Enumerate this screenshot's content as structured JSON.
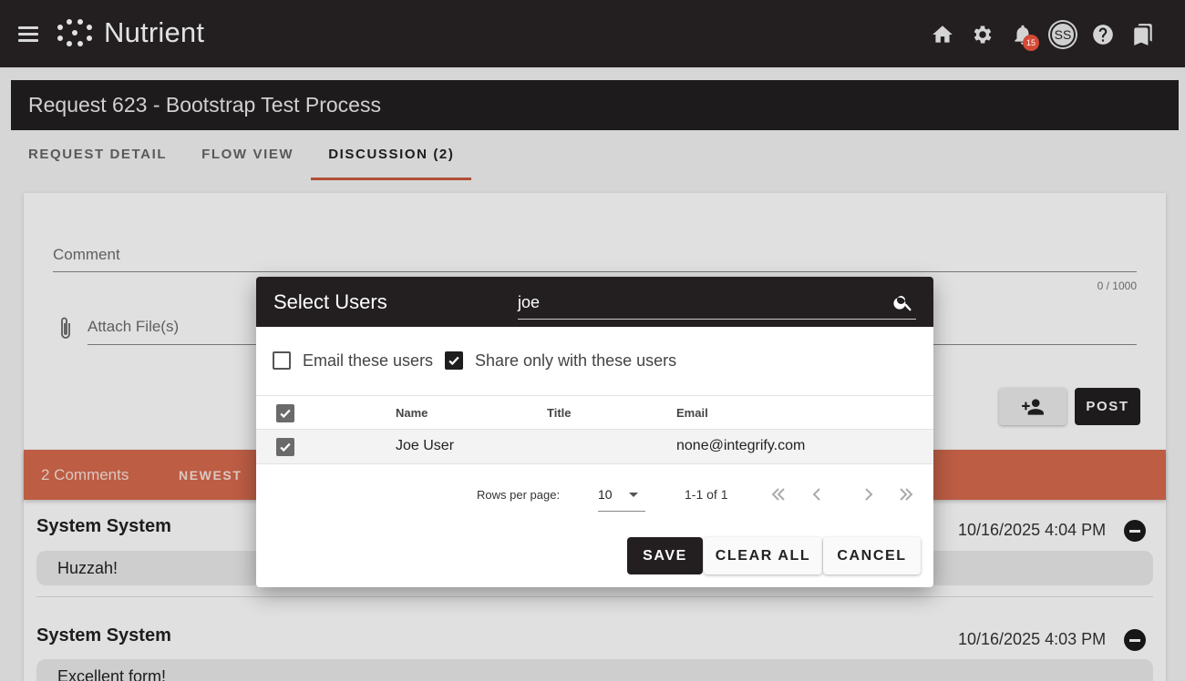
{
  "app": {
    "name": "Nutrient",
    "notification_count": "15",
    "avatar_initials": "SS"
  },
  "page": {
    "title": "Request 623 - Bootstrap Test Process",
    "tabs": [
      {
        "label": "REQUEST DETAIL"
      },
      {
        "label": "FLOW VIEW"
      },
      {
        "label": "DISCUSSION (2)"
      }
    ]
  },
  "discussion": {
    "comment_placeholder": "Comment",
    "counter": "0 / 1000",
    "attach_placeholder": "Attach File(s)",
    "post_label": "POST",
    "comments_count_label": "2 Comments",
    "sort_label": "NEWEST",
    "comments": [
      {
        "author": "System System",
        "date": "10/16/2025 4:04 PM",
        "text": "Huzzah!"
      },
      {
        "author": "System System",
        "date": "10/16/2025 4:03 PM",
        "text": "Excellent form!"
      }
    ]
  },
  "dialog": {
    "title": "Select Users",
    "search_value": "joe",
    "email_label": "Email these users",
    "email_checked": false,
    "share_label": "Share only with these users",
    "share_checked": true,
    "columns": [
      "Name",
      "Title",
      "Email"
    ],
    "rows": [
      {
        "name": "Joe User",
        "title": "",
        "email": "none@integrify.com",
        "checked": true
      }
    ],
    "rows_per_page_label": "Rows per page:",
    "rows_per_page_value": "10",
    "range_label": "1-1 of 1",
    "save_label": "SAVE",
    "clear_label": "CLEAR ALL",
    "cancel_label": "CANCEL"
  },
  "colors": {
    "appbar": "#231f20",
    "accent": "#d76a4e",
    "tab_underline": "#c85a3e",
    "badge": "#d44a35"
  }
}
